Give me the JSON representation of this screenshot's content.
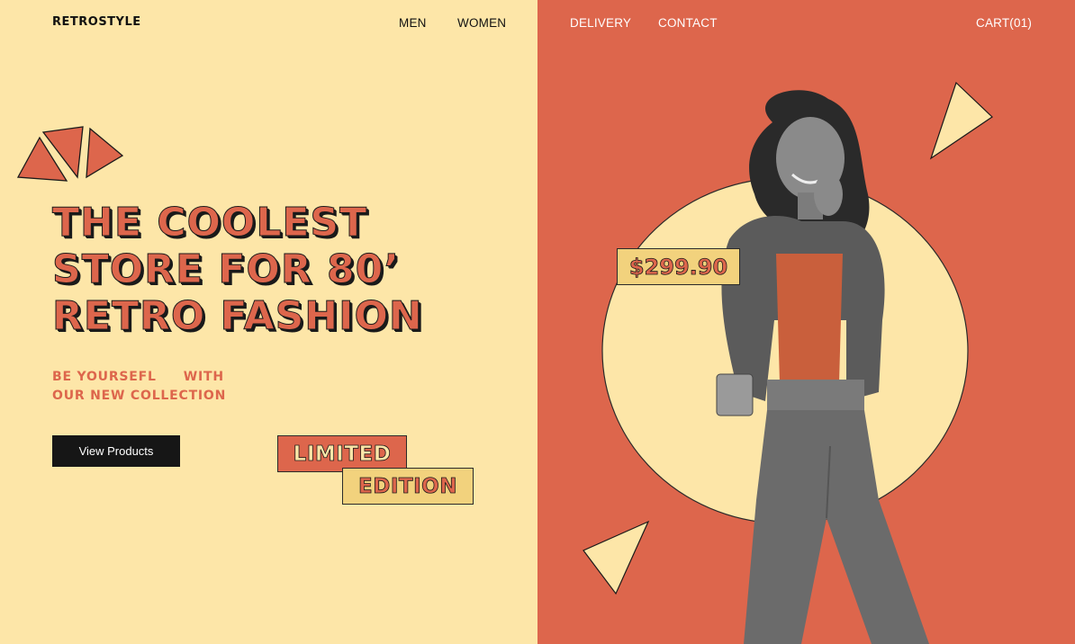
{
  "brand": {
    "logo": "RETROSTYLE"
  },
  "nav": {
    "men": "MEN",
    "women": "WOMEN",
    "delivery": "DELIVERY",
    "contact": "CONTACT",
    "cart": "CART(01)"
  },
  "hero": {
    "headline": [
      "THE COOLEST",
      "STORE FOR 80’",
      "RETRO FASHION"
    ],
    "tagline_line1_a": "BE YOURSEFL",
    "tagline_line1_b": "WITH",
    "tagline_line2": "OUR NEW COLLECTION",
    "cta_label": "View Products",
    "badge_limited": "LIMITED",
    "badge_edition": "EDITION"
  },
  "product": {
    "price": "$299.90"
  },
  "colors": {
    "cream": "#fde6a8",
    "coral": "#dd664c",
    "mustard": "#f2d27d",
    "dark": "#161616"
  },
  "icons": {
    "model_photo": "person-photo-grayscale"
  }
}
